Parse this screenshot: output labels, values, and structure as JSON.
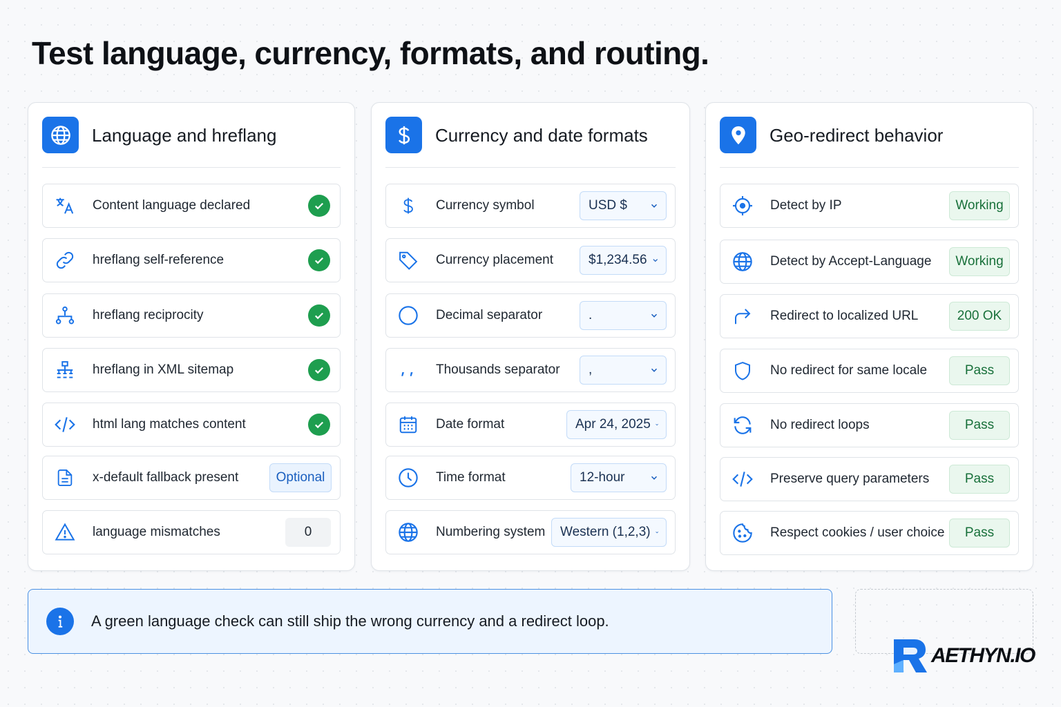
{
  "page": {
    "title": "Test language, currency, formats, and routing."
  },
  "panels": [
    {
      "title": "Language and hreflang",
      "icon": "globe-icon",
      "rows": [
        {
          "label": "Content language declared",
          "icon": "translate-icon",
          "status": "check"
        },
        {
          "label": "hreflang self-reference",
          "icon": "link-icon",
          "status": "check"
        },
        {
          "label": "hreflang reciprocity",
          "icon": "network-icon",
          "status": "check"
        },
        {
          "label": "hreflang in XML sitemap",
          "icon": "sitemap-icon",
          "status": "check"
        },
        {
          "label": "html lang matches content",
          "icon": "code-icon",
          "status": "check"
        },
        {
          "label": "x-default fallback present",
          "icon": "document-icon",
          "status": "Optional"
        },
        {
          "label": "language mismatches",
          "icon": "warning-icon",
          "status": "0"
        }
      ]
    },
    {
      "title": "Currency and date formats",
      "icon": "dollar-icon",
      "rows": [
        {
          "label": "Currency symbol",
          "icon": "dollar-icon",
          "value": "USD $"
        },
        {
          "label": "Currency placement",
          "icon": "tag-icon",
          "value": "$1,234.56"
        },
        {
          "label": "Decimal separator",
          "icon": "circle-icon",
          "value": "."
        },
        {
          "label": "Thousands separator",
          "icon": "comma-icon",
          "value": ","
        },
        {
          "label": "Date format",
          "icon": "calendar-icon",
          "value": "Apr 24, 2025"
        },
        {
          "label": "Time format",
          "icon": "clock-icon",
          "value": "12-hour"
        },
        {
          "label": "Numbering system",
          "icon": "globe-icon",
          "value": "Western (1,2,3)"
        }
      ]
    },
    {
      "title": "Geo-redirect behavior",
      "icon": "location-pin-icon",
      "rows": [
        {
          "label": "Detect by IP",
          "icon": "crosshair-icon",
          "status": "Working"
        },
        {
          "label": "Detect by Accept-Language",
          "icon": "globe-icon",
          "status": "Working"
        },
        {
          "label": "Redirect to localized URL",
          "icon": "redirect-arrow-icon",
          "status": "200 OK"
        },
        {
          "label": "No redirect for same locale",
          "icon": "shield-icon",
          "status": "Pass"
        },
        {
          "label": "No redirect loops",
          "icon": "refresh-icon",
          "status": "Pass"
        },
        {
          "label": "Preserve query parameters",
          "icon": "code-icon",
          "status": "Pass"
        },
        {
          "label": "Respect cookies / user choice",
          "icon": "cookie-icon",
          "status": "Pass"
        }
      ]
    }
  ],
  "callout": {
    "text": "A green language check can still ship the wrong currency and a redirect loop.",
    "icon": "info-icon"
  },
  "brand": {
    "name": "AETHYN.IO"
  },
  "colors": {
    "accent": "#1a73e8",
    "success": "#1e9e4f",
    "success_bg": "#eaf7ee",
    "info_bg": "#edf5ff"
  }
}
